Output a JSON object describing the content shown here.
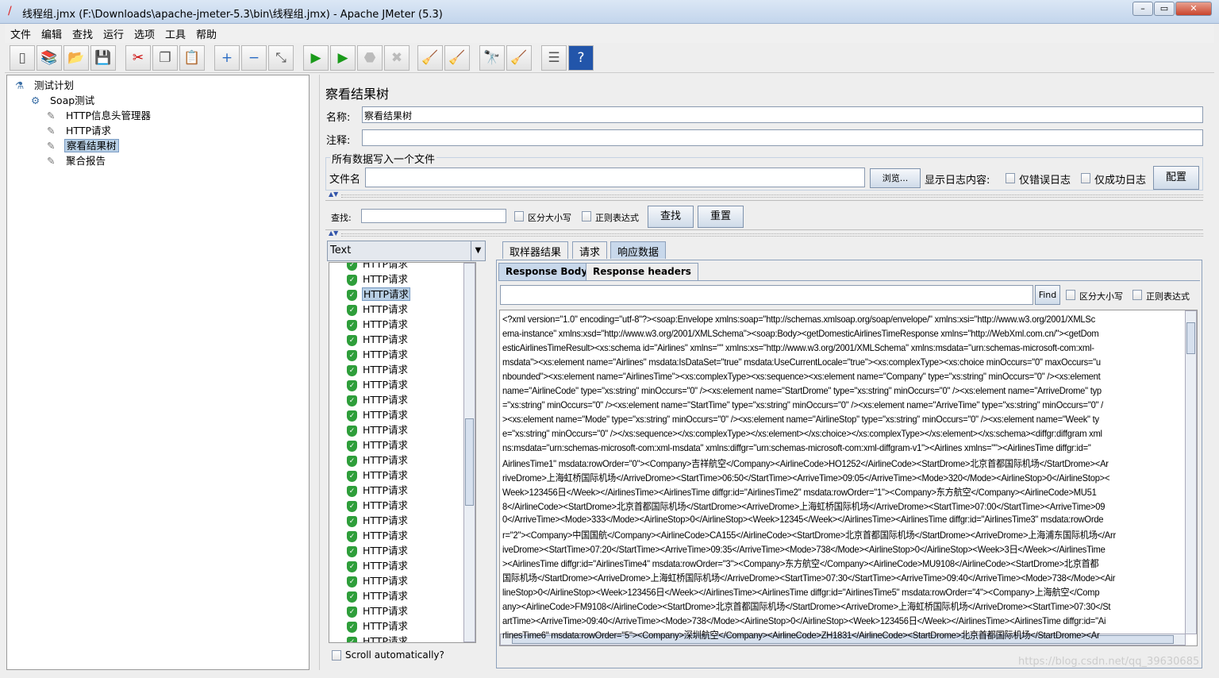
{
  "window": {
    "title": "线程组.jmx (F:\\Downloads\\apache-jmeter-5.3\\bin\\线程组.jmx) - Apache JMeter (5.3)"
  },
  "menu": [
    "文件",
    "编辑",
    "查找",
    "运行",
    "选项",
    "工具",
    "帮助"
  ],
  "toolbar": [
    {
      "icon": "new-icon",
      "glyph": "▯"
    },
    {
      "icon": "templates-icon",
      "glyph": "📚"
    },
    {
      "icon": "open-icon",
      "glyph": "📂"
    },
    {
      "icon": "save-icon",
      "glyph": "💾"
    },
    {
      "icon": "cut-icon",
      "glyph": "✂"
    },
    {
      "icon": "copy-icon",
      "glyph": "❐"
    },
    {
      "icon": "paste-icon",
      "glyph": "📋"
    },
    {
      "icon": "expand-icon",
      "glyph": "+"
    },
    {
      "icon": "collapse-icon",
      "glyph": "−"
    },
    {
      "icon": "toggle-icon",
      "glyph": "⤡"
    },
    {
      "icon": "start-icon",
      "glyph": "▶"
    },
    {
      "icon": "start-no-pause-icon",
      "glyph": "▶"
    },
    {
      "icon": "stop-icon",
      "glyph": "⬣"
    },
    {
      "icon": "shutdown-icon",
      "glyph": "✖"
    },
    {
      "icon": "clear-icon",
      "glyph": "🧹"
    },
    {
      "icon": "clear-all-icon",
      "glyph": "🧹"
    },
    {
      "icon": "search-icon",
      "glyph": "🔭"
    },
    {
      "icon": "reset-search-icon",
      "glyph": "🧹"
    },
    {
      "icon": "function-helper-icon",
      "glyph": "☰"
    },
    {
      "icon": "help-icon",
      "glyph": "?"
    }
  ],
  "tree": [
    {
      "label": "测试计划",
      "level": 0
    },
    {
      "label": "Soap测试",
      "level": 1
    },
    {
      "label": "HTTP信息头管理器",
      "level": 2
    },
    {
      "label": "HTTP请求",
      "level": 2
    },
    {
      "label": "察看结果树",
      "level": 2,
      "selected": true
    },
    {
      "label": "聚合报告",
      "level": 2
    }
  ],
  "panel": {
    "title": "察看结果树",
    "name_label": "名称:",
    "name_value": "察看结果树",
    "comment_label": "注释:",
    "comment_value": "",
    "file_group": "所有数据写入一个文件",
    "file_label": "文件名",
    "file_value": "",
    "browse": "浏览...",
    "log_label": "显示日志内容:",
    "errors_only": "仅错误日志",
    "success_only": "仅成功日志",
    "configure": "配置",
    "search_label": "查找:",
    "search_value": "",
    "case_sensitive": "区分大小写",
    "regex": "正则表达式",
    "search_btn": "查找",
    "reset_btn": "重置"
  },
  "renderer": "Text",
  "results": [
    "HTTP请求",
    "HTTP请求",
    "HTTP请求",
    "HTTP请求",
    "HTTP请求",
    "HTTP请求",
    "HTTP请求",
    "HTTP请求",
    "HTTP请求",
    "HTTP请求",
    "HTTP请求",
    "HTTP请求",
    "HTTP请求",
    "HTTP请求",
    "HTTP请求",
    "HTTP请求",
    "HTTP请求",
    "HTTP请求",
    "HTTP请求",
    "HTTP请求",
    "HTTP请求",
    "HTTP请求",
    "HTTP请求",
    "HTTP请求",
    "HTTP请求",
    "HTTP请求"
  ],
  "selected_result": 2,
  "scroll_auto": "Scroll automatically?",
  "tabs": [
    "取样器结果",
    "请求",
    "响应数据"
  ],
  "active_tab": 2,
  "subtabs": [
    "Response Body",
    "Response headers"
  ],
  "find": {
    "button": "Find",
    "case_sensitive": "区分大小写",
    "regex": "正则表达式",
    "value": ""
  },
  "response_lines": [
    "<?xml version=\"1.0\" encoding=\"utf-8\"?><soap:Envelope xmlns:soap=\"http://schemas.xmlsoap.org/soap/envelope/\" xmlns:xsi=\"http://www.w3.org/2001/XMLSc",
    "ema-instance\" xmlns:xsd=\"http://www.w3.org/2001/XMLSchema\"><soap:Body><getDomesticAirlinesTimeResponse xmlns=\"http://WebXml.com.cn/\"><getDom",
    "esticAirlinesTimeResult><xs:schema id=\"Airlines\" xmlns=\"\" xmlns:xs=\"http://www.w3.org/2001/XMLSchema\" xmlns:msdata=\"urn:schemas-microsoft-com:xml-",
    "msdata\"><xs:element name=\"Airlines\" msdata:IsDataSet=\"true\" msdata:UseCurrentLocale=\"true\"><xs:complexType><xs:choice minOccurs=\"0\" maxOccurs=\"u",
    "nbounded\"><xs:element name=\"AirlinesTime\"><xs:complexType><xs:sequence><xs:element name=\"Company\" type=\"xs:string\" minOccurs=\"0\" /><xs:element",
    "name=\"AirlineCode\" type=\"xs:string\" minOccurs=\"0\" /><xs:element name=\"StartDrome\" type=\"xs:string\" minOccurs=\"0\" /><xs:element name=\"ArriveDrome\" typ",
    "=\"xs:string\" minOccurs=\"0\" /><xs:element name=\"StartTime\" type=\"xs:string\" minOccurs=\"0\" /><xs:element name=\"ArriveTime\" type=\"xs:string\" minOccurs=\"0\" /",
    "><xs:element name=\"Mode\" type=\"xs:string\" minOccurs=\"0\" /><xs:element name=\"AirlineStop\" type=\"xs:string\" minOccurs=\"0\" /><xs:element name=\"Week\" ty",
    "e=\"xs:string\" minOccurs=\"0\" /></xs:sequence></xs:complexType></xs:element></xs:choice></xs:complexType></xs:element></xs:schema><diffgr:diffgram xml",
    "ns:msdata=\"urn:schemas-microsoft-com:xml-msdata\" xmlns:diffgr=\"urn:schemas-microsoft-com:xml-diffgram-v1\"><Airlines xmlns=\"\"><AirlinesTime diffgr:id=\"",
    "AirlinesTime1\" msdata:rowOrder=\"0\"><Company>吉祥航空</Company><AirlineCode>HO1252</AirlineCode><StartDrome>北京首都国际机场</StartDrome><Ar",
    "riveDrome>上海虹桥国际机场</ArriveDrome><StartTime>06:50</StartTime><ArriveTime>09:05</ArriveTime><Mode>320</Mode><AirlineStop>0</AirlineStop><",
    "Week>123456日</Week></AirlinesTime><AirlinesTime diffgr:id=\"AirlinesTime2\" msdata:rowOrder=\"1\"><Company>东方航空</Company><AirlineCode>MU51",
    "8</AirlineCode><StartDrome>北京首都国际机场</StartDrome><ArriveDrome>上海虹桥国际机场</ArriveDrome><StartTime>07:00</StartTime><ArriveTime>09",
    "0</ArriveTime><Mode>333</Mode><AirlineStop>0</AirlineStop><Week>12345</Week></AirlinesTime><AirlinesTime diffgr:id=\"AirlinesTime3\" msdata:rowOrde",
    "r=\"2\"><Company>中国国航</Company><AirlineCode>CA155</AirlineCode><StartDrome>北京首都国际机场</StartDrome><ArriveDrome>上海浦东国际机场</Arr",
    "iveDrome><StartTime>07:20</StartTime><ArriveTime>09:35</ArriveTime><Mode>738</Mode><AirlineStop>0</AirlineStop><Week>3日</Week></AirlinesTime",
    "><AirlinesTime diffgr:id=\"AirlinesTime4\" msdata:rowOrder=\"3\"><Company>东方航空</Company><AirlineCode>MU9108</AirlineCode><StartDrome>北京首都",
    "国际机场</StartDrome><ArriveDrome>上海虹桥国际机场</ArriveDrome><StartTime>07:30</StartTime><ArriveTime>09:40</ArriveTime><Mode>738</Mode><Air",
    "lineStop>0</AirlineStop><Week>123456日</Week></AirlinesTime><AirlinesTime diffgr:id=\"AirlinesTime5\" msdata:rowOrder=\"4\"><Company>上海航空</Comp",
    "any><AirlineCode>FM9108</AirlineCode><StartDrome>北京首都国际机场</StartDrome><ArriveDrome>上海虹桥国际机场</ArriveDrome><StartTime>07:30</St",
    "artTime><ArriveTime>09:40</ArriveTime><Mode>738</Mode><AirlineStop>0</AirlineStop><Week>123456日</Week></AirlinesTime><AirlinesTime diffgr:id=\"Ai",
    "rlinesTime6\" msdata:rowOrder=\"5\"><Company>深圳航空</Company><AirlineCode>ZH1831</AirlineCode><StartDrome>北京首都国际机场</StartDrome><Ar"
  ],
  "watermark": "https://blog.csdn.net/qq_39630685"
}
